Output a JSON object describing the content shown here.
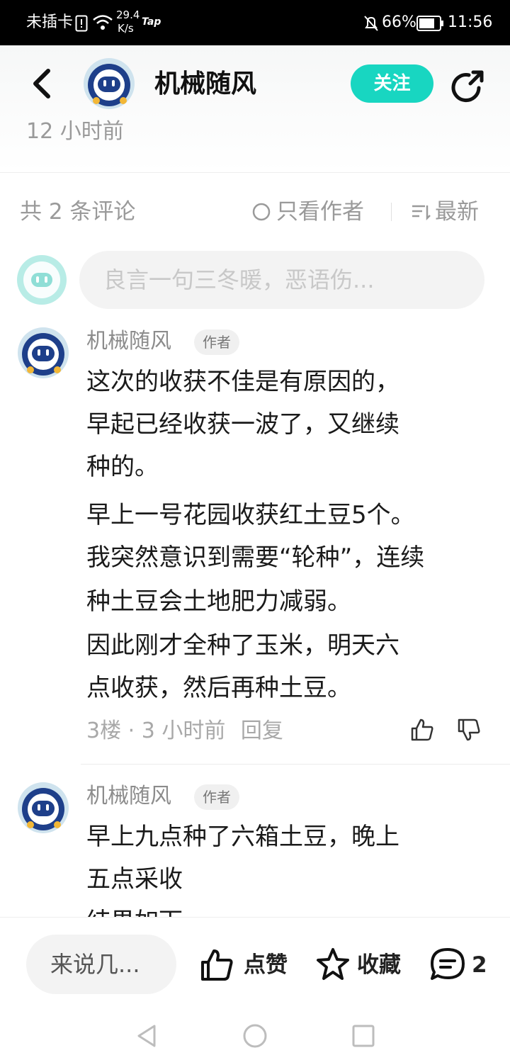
{
  "status_bar": {
    "carrier": "未插卡",
    "net_speed_value": "29.4",
    "net_speed_unit": "K/s",
    "app_badge": "Tap",
    "battery": "66%",
    "time": "11:56"
  },
  "header": {
    "author_name": "机械随风",
    "follow_label": "关注",
    "time_ago": "12 小时前"
  },
  "comments_toolbar": {
    "count_label": "共 2 条评论",
    "author_only_label": "只看作者",
    "sort_label": "最新"
  },
  "compose": {
    "placeholder": "良言一句三冬暖，恶语伤..."
  },
  "comments": [
    {
      "author": "机械随风",
      "badge": "作者",
      "lines": [
        "这次的收获不佳是有原因的，",
        "早起已经收获一波了，又继续",
        "种的。",
        "早上一号花园收获红土豆5个。",
        "我突然意识到需要“轮种”，连续",
        "种土豆会土地肥力减弱。",
        "因此刚才全种了玉米，明天六",
        "点收获，然后再种土豆。"
      ],
      "floor": "3楼",
      "time": "3 小时前",
      "reply_label": "回复"
    },
    {
      "author": "机械随风",
      "badge": "作者",
      "lines": [
        "早上九点种了六箱土豆，晚上",
        "五点采收",
        "结果如下"
      ]
    }
  ],
  "bottom_bar": {
    "input_placeholder": "来说几...",
    "like_label": "点赞",
    "favorite_label": "收藏",
    "comment_count": "2"
  },
  "colors": {
    "accent": "#18d6c1",
    "avatar_bg": "#1e3f8a",
    "muted_text": "#9a9a9a"
  }
}
